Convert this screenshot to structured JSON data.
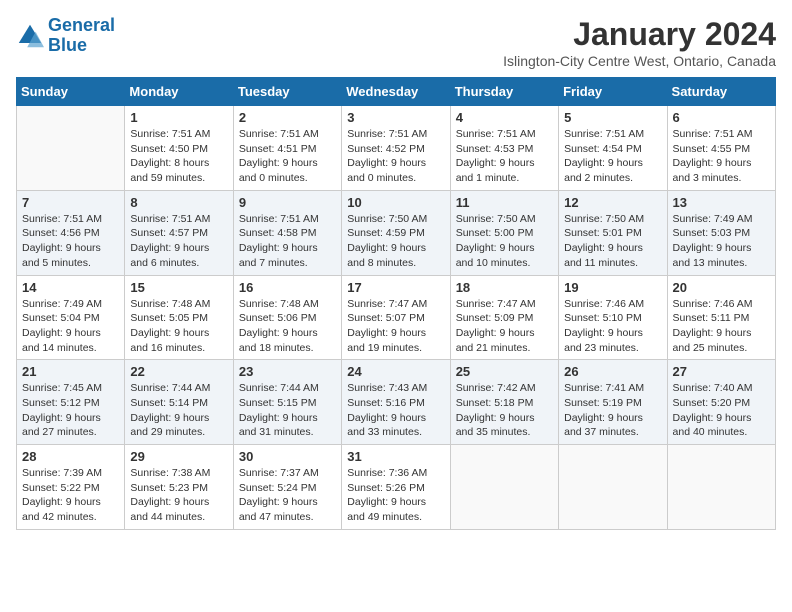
{
  "logo": {
    "name_part1": "General",
    "name_part2": "Blue"
  },
  "header": {
    "month": "January 2024",
    "location": "Islington-City Centre West, Ontario, Canada"
  },
  "days_of_week": [
    "Sunday",
    "Monday",
    "Tuesday",
    "Wednesday",
    "Thursday",
    "Friday",
    "Saturday"
  ],
  "weeks": [
    [
      {
        "day": "",
        "sunrise": "",
        "sunset": "",
        "daylight": ""
      },
      {
        "day": "1",
        "sunrise": "Sunrise: 7:51 AM",
        "sunset": "Sunset: 4:50 PM",
        "daylight": "Daylight: 8 hours and 59 minutes."
      },
      {
        "day": "2",
        "sunrise": "Sunrise: 7:51 AM",
        "sunset": "Sunset: 4:51 PM",
        "daylight": "Daylight: 9 hours and 0 minutes."
      },
      {
        "day": "3",
        "sunrise": "Sunrise: 7:51 AM",
        "sunset": "Sunset: 4:52 PM",
        "daylight": "Daylight: 9 hours and 0 minutes."
      },
      {
        "day": "4",
        "sunrise": "Sunrise: 7:51 AM",
        "sunset": "Sunset: 4:53 PM",
        "daylight": "Daylight: 9 hours and 1 minute."
      },
      {
        "day": "5",
        "sunrise": "Sunrise: 7:51 AM",
        "sunset": "Sunset: 4:54 PM",
        "daylight": "Daylight: 9 hours and 2 minutes."
      },
      {
        "day": "6",
        "sunrise": "Sunrise: 7:51 AM",
        "sunset": "Sunset: 4:55 PM",
        "daylight": "Daylight: 9 hours and 3 minutes."
      }
    ],
    [
      {
        "day": "7",
        "sunrise": "Sunrise: 7:51 AM",
        "sunset": "Sunset: 4:56 PM",
        "daylight": "Daylight: 9 hours and 5 minutes."
      },
      {
        "day": "8",
        "sunrise": "Sunrise: 7:51 AM",
        "sunset": "Sunset: 4:57 PM",
        "daylight": "Daylight: 9 hours and 6 minutes."
      },
      {
        "day": "9",
        "sunrise": "Sunrise: 7:51 AM",
        "sunset": "Sunset: 4:58 PM",
        "daylight": "Daylight: 9 hours and 7 minutes."
      },
      {
        "day": "10",
        "sunrise": "Sunrise: 7:50 AM",
        "sunset": "Sunset: 4:59 PM",
        "daylight": "Daylight: 9 hours and 8 minutes."
      },
      {
        "day": "11",
        "sunrise": "Sunrise: 7:50 AM",
        "sunset": "Sunset: 5:00 PM",
        "daylight": "Daylight: 9 hours and 10 minutes."
      },
      {
        "day": "12",
        "sunrise": "Sunrise: 7:50 AM",
        "sunset": "Sunset: 5:01 PM",
        "daylight": "Daylight: 9 hours and 11 minutes."
      },
      {
        "day": "13",
        "sunrise": "Sunrise: 7:49 AM",
        "sunset": "Sunset: 5:03 PM",
        "daylight": "Daylight: 9 hours and 13 minutes."
      }
    ],
    [
      {
        "day": "14",
        "sunrise": "Sunrise: 7:49 AM",
        "sunset": "Sunset: 5:04 PM",
        "daylight": "Daylight: 9 hours and 14 minutes."
      },
      {
        "day": "15",
        "sunrise": "Sunrise: 7:48 AM",
        "sunset": "Sunset: 5:05 PM",
        "daylight": "Daylight: 9 hours and 16 minutes."
      },
      {
        "day": "16",
        "sunrise": "Sunrise: 7:48 AM",
        "sunset": "Sunset: 5:06 PM",
        "daylight": "Daylight: 9 hours and 18 minutes."
      },
      {
        "day": "17",
        "sunrise": "Sunrise: 7:47 AM",
        "sunset": "Sunset: 5:07 PM",
        "daylight": "Daylight: 9 hours and 19 minutes."
      },
      {
        "day": "18",
        "sunrise": "Sunrise: 7:47 AM",
        "sunset": "Sunset: 5:09 PM",
        "daylight": "Daylight: 9 hours and 21 minutes."
      },
      {
        "day": "19",
        "sunrise": "Sunrise: 7:46 AM",
        "sunset": "Sunset: 5:10 PM",
        "daylight": "Daylight: 9 hours and 23 minutes."
      },
      {
        "day": "20",
        "sunrise": "Sunrise: 7:46 AM",
        "sunset": "Sunset: 5:11 PM",
        "daylight": "Daylight: 9 hours and 25 minutes."
      }
    ],
    [
      {
        "day": "21",
        "sunrise": "Sunrise: 7:45 AM",
        "sunset": "Sunset: 5:12 PM",
        "daylight": "Daylight: 9 hours and 27 minutes."
      },
      {
        "day": "22",
        "sunrise": "Sunrise: 7:44 AM",
        "sunset": "Sunset: 5:14 PM",
        "daylight": "Daylight: 9 hours and 29 minutes."
      },
      {
        "day": "23",
        "sunrise": "Sunrise: 7:44 AM",
        "sunset": "Sunset: 5:15 PM",
        "daylight": "Daylight: 9 hours and 31 minutes."
      },
      {
        "day": "24",
        "sunrise": "Sunrise: 7:43 AM",
        "sunset": "Sunset: 5:16 PM",
        "daylight": "Daylight: 9 hours and 33 minutes."
      },
      {
        "day": "25",
        "sunrise": "Sunrise: 7:42 AM",
        "sunset": "Sunset: 5:18 PM",
        "daylight": "Daylight: 9 hours and 35 minutes."
      },
      {
        "day": "26",
        "sunrise": "Sunrise: 7:41 AM",
        "sunset": "Sunset: 5:19 PM",
        "daylight": "Daylight: 9 hours and 37 minutes."
      },
      {
        "day": "27",
        "sunrise": "Sunrise: 7:40 AM",
        "sunset": "Sunset: 5:20 PM",
        "daylight": "Daylight: 9 hours and 40 minutes."
      }
    ],
    [
      {
        "day": "28",
        "sunrise": "Sunrise: 7:39 AM",
        "sunset": "Sunset: 5:22 PM",
        "daylight": "Daylight: 9 hours and 42 minutes."
      },
      {
        "day": "29",
        "sunrise": "Sunrise: 7:38 AM",
        "sunset": "Sunset: 5:23 PM",
        "daylight": "Daylight: 9 hours and 44 minutes."
      },
      {
        "day": "30",
        "sunrise": "Sunrise: 7:37 AM",
        "sunset": "Sunset: 5:24 PM",
        "daylight": "Daylight: 9 hours and 47 minutes."
      },
      {
        "day": "31",
        "sunrise": "Sunrise: 7:36 AM",
        "sunset": "Sunset: 5:26 PM",
        "daylight": "Daylight: 9 hours and 49 minutes."
      },
      {
        "day": "",
        "sunrise": "",
        "sunset": "",
        "daylight": ""
      },
      {
        "day": "",
        "sunrise": "",
        "sunset": "",
        "daylight": ""
      },
      {
        "day": "",
        "sunrise": "",
        "sunset": "",
        "daylight": ""
      }
    ]
  ]
}
